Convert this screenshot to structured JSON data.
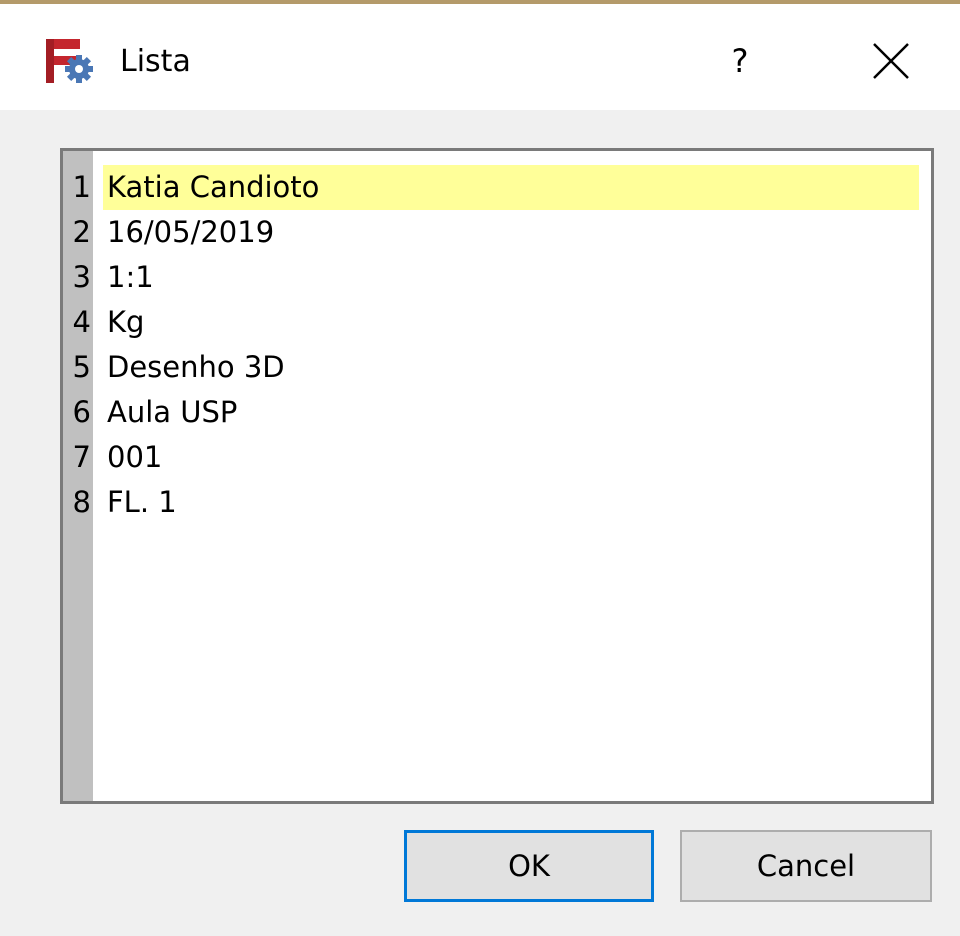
{
  "window": {
    "title": "Lista",
    "help_label": "?",
    "icon": "freecad-gear-icon",
    "accent_color": "#0078d7"
  },
  "list": {
    "items": [
      {
        "number": "1",
        "value": "Katia Candioto",
        "selected": true
      },
      {
        "number": "2",
        "value": "16/05/2019",
        "selected": false
      },
      {
        "number": "3",
        "value": "1:1",
        "selected": false
      },
      {
        "number": "4",
        "value": "Kg",
        "selected": false
      },
      {
        "number": "5",
        "value": "Desenho 3D",
        "selected": false
      },
      {
        "number": "6",
        "value": "Aula USP",
        "selected": false
      },
      {
        "number": "7",
        "value": "001",
        "selected": false
      },
      {
        "number": "8",
        "value": "FL. 1",
        "selected": false
      }
    ],
    "highlight_color": "#ffff99"
  },
  "buttons": {
    "ok_label": "OK",
    "cancel_label": "Cancel"
  }
}
